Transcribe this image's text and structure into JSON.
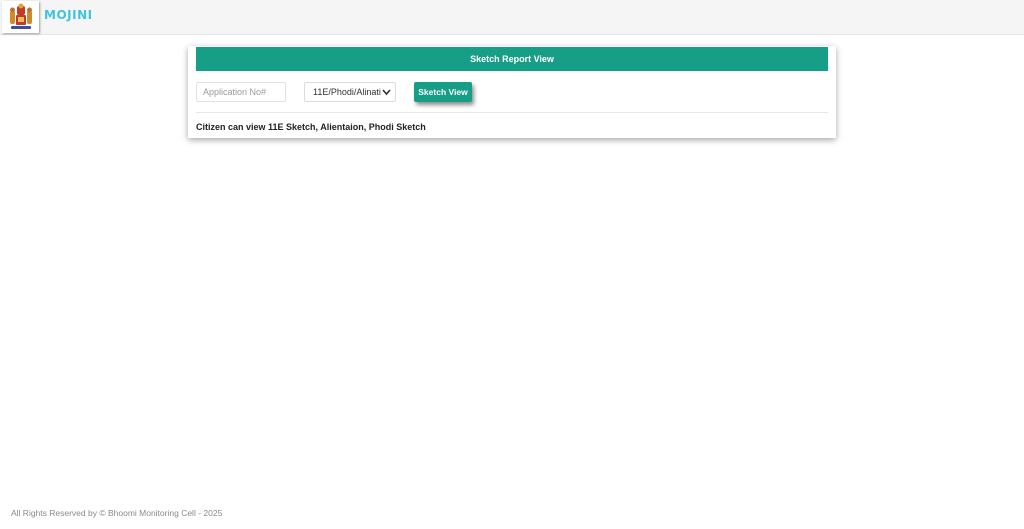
{
  "header": {
    "brand": "MOJINI",
    "logo_icon": "karnataka-emblem-icon",
    "brand_color": "#3fc4dc"
  },
  "card": {
    "title": "Sketch Report View",
    "header_color": "#179e86",
    "application_input": {
      "placeholder": "Application No#",
      "value": ""
    },
    "sketch_type": {
      "selected": "11E/Phodi/Alinati"
    },
    "view_button_label": "Sketch View",
    "note": "Citizen can view 11E Sketch, Alientaion, Phodi Sketch"
  },
  "footer": {
    "text": "All Rights Reserved by © Bhoomi Monitoring Cell - 2025"
  }
}
